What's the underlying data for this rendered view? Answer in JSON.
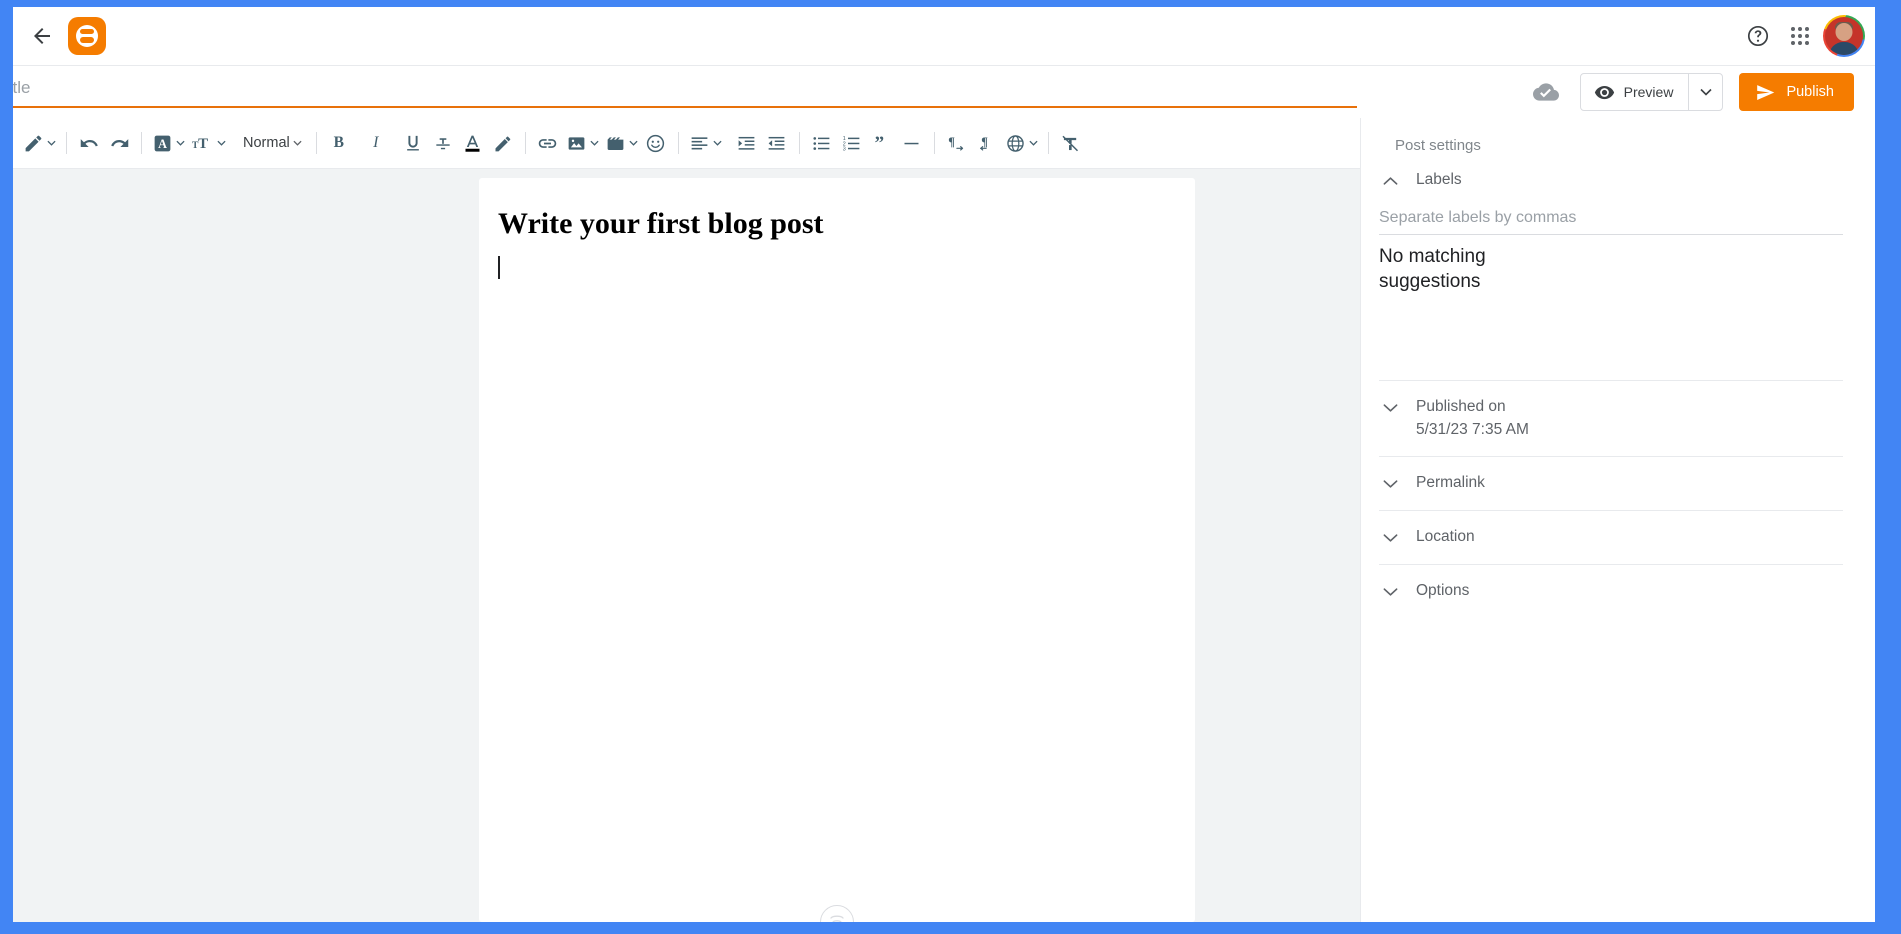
{
  "window": {
    "frame_color": "#4285f4"
  },
  "topbar": {
    "back_label": "Back",
    "logo_label": "Blogger",
    "help_label": "Help",
    "apps_label": "Google apps",
    "account_label": "Google Account"
  },
  "title": {
    "value": "",
    "placeholder": "Title"
  },
  "actions": {
    "save_status": "Saved",
    "preview_label": "Preview",
    "preview_caret_label": "Preview options",
    "publish_label": "Publish"
  },
  "toolbar": {
    "items": [
      {
        "name": "compose-mode",
        "icon": "pencil-icon",
        "label": "Compose mode",
        "caret": true
      },
      {
        "name": "undo",
        "icon": "undo-icon",
        "label": "Undo",
        "caret": false
      },
      {
        "name": "redo",
        "icon": "redo-icon",
        "label": "Redo",
        "caret": false
      },
      {
        "name": "font-family",
        "icon": "font-box-icon",
        "label": "Font",
        "caret": true
      },
      {
        "name": "font-size",
        "icon": "font-size-icon",
        "label": "Font size",
        "caret": true
      },
      {
        "name": "paragraph-style",
        "icon": "text-style",
        "label": "Normal",
        "caret": true
      },
      {
        "name": "bold",
        "icon": "bold-icon",
        "label": "Bold",
        "caret": false
      },
      {
        "name": "italic",
        "icon": "italic-icon",
        "label": "Italic",
        "caret": false
      },
      {
        "name": "underline",
        "icon": "underline-icon",
        "label": "Underline",
        "caret": false
      },
      {
        "name": "strikethrough",
        "icon": "strikethrough-icon",
        "label": "Strikethrough",
        "caret": false
      },
      {
        "name": "text-color",
        "icon": "text-color-icon",
        "label": "Text color",
        "caret": false
      },
      {
        "name": "highlight-color",
        "icon": "highlight-pen-icon",
        "label": "Highlight color",
        "caret": false
      },
      {
        "name": "insert-link",
        "icon": "link-icon",
        "label": "Link",
        "caret": false
      },
      {
        "name": "insert-image",
        "icon": "image-icon",
        "label": "Insert image",
        "caret": true
      },
      {
        "name": "insert-video",
        "icon": "video-icon",
        "label": "Insert video",
        "caret": true
      },
      {
        "name": "insert-emoji",
        "icon": "emoji-icon",
        "label": "Insert emoji",
        "caret": false
      },
      {
        "name": "align",
        "icon": "align-left-icon",
        "label": "Alignment",
        "caret": true
      },
      {
        "name": "indent-increase",
        "icon": "indent-increase-icon",
        "label": "Increase indent",
        "caret": false
      },
      {
        "name": "indent-decrease",
        "icon": "indent-decrease-icon",
        "label": "Decrease indent",
        "caret": false
      },
      {
        "name": "bulleted-list",
        "icon": "bulleted-list-icon",
        "label": "Bulleted list",
        "caret": false
      },
      {
        "name": "numbered-list",
        "icon": "numbered-list-icon",
        "label": "Numbered list",
        "caret": false
      },
      {
        "name": "blockquote",
        "icon": "quote-icon",
        "label": "Quote",
        "caret": false
      },
      {
        "name": "horizontal-rule",
        "icon": "horizontal-line-icon",
        "label": "Insert jump break",
        "caret": false
      },
      {
        "name": "ltr-direction",
        "icon": "ltr-paragraph-icon",
        "label": "Left to right",
        "caret": false
      },
      {
        "name": "rtl-direction",
        "icon": "rtl-paragraph-icon",
        "label": "Right to left",
        "caret": false
      },
      {
        "name": "transliteration",
        "icon": "globe-icon",
        "label": "Input tools",
        "caret": true
      },
      {
        "name": "clear-formatting",
        "icon": "clear-formatting-icon",
        "label": "Remove formatting",
        "caret": false
      }
    ],
    "style_value": "Normal"
  },
  "editor": {
    "heading": "Write your first blog post",
    "body": "",
    "resize_label": "Resize editor"
  },
  "sidebar": {
    "title": "Post settings",
    "sections": [
      {
        "name": "labels",
        "label": "Labels",
        "expanded": true,
        "chevron": "chevron-up-icon",
        "input_placeholder": "Separate labels by commas",
        "input_value": "",
        "suggestions_text": "No matching suggestions"
      },
      {
        "name": "published-on",
        "label": "Published on",
        "sublabel": "5/31/23 7:35 AM",
        "expanded": false,
        "chevron": "chevron-down-icon"
      },
      {
        "name": "permalink",
        "label": "Permalink",
        "expanded": false,
        "chevron": "chevron-down-icon"
      },
      {
        "name": "location",
        "label": "Location",
        "expanded": false,
        "chevron": "chevron-down-icon"
      },
      {
        "name": "options",
        "label": "Options",
        "expanded": false,
        "chevron": "chevron-down-icon"
      }
    ]
  },
  "colors": {
    "brand_orange": "#f57c00",
    "accent_blue": "#4285f4",
    "toolbar_icon": "#44606e",
    "editor_background": "#f1f3f4",
    "title_underline": "#e8710a"
  }
}
